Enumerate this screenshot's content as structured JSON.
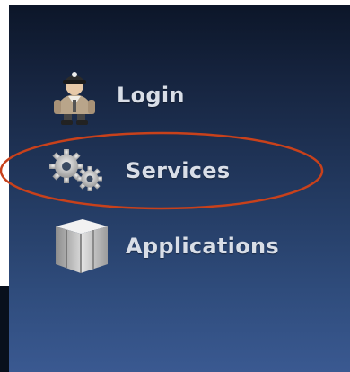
{
  "nav": {
    "items": [
      {
        "label": "Login",
        "icon": "user-icon"
      },
      {
        "label": "Services",
        "icon": "gears-icon",
        "highlighted": true
      },
      {
        "label": "Applications",
        "icon": "package-icon"
      }
    ]
  },
  "colors": {
    "panel_top": "#0c1629",
    "panel_bottom": "#3a5991",
    "label_text": "#d9dee7",
    "highlight_ring": "#c8411b"
  }
}
